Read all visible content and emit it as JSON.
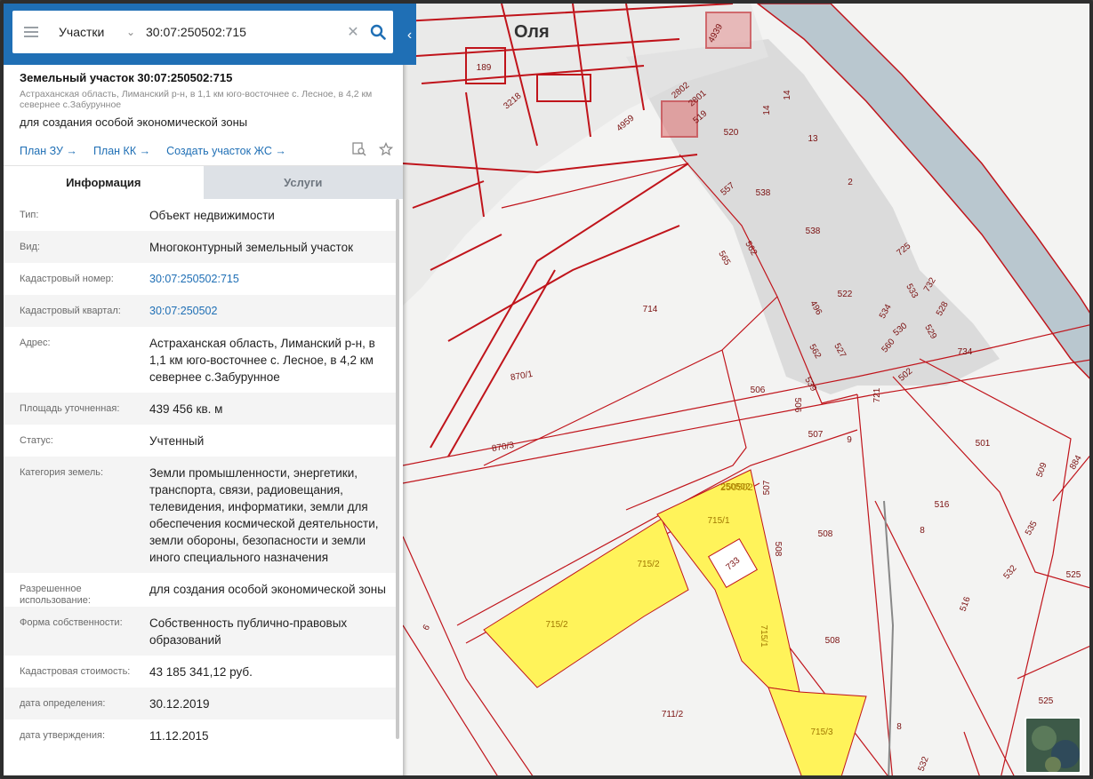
{
  "search": {
    "layer": "Участки",
    "query": "30:07:250502:715"
  },
  "object": {
    "title": "Земельный участок 30:07:250502:715",
    "address_short": "Астраханская область, Лиманский р-н, в 1,1 км юго-восточнее с. Лесное, в 4,2 км севернее с.Забурунное",
    "purpose": "для создания особой экономической зоны",
    "links": [
      "План ЗУ →",
      "План КК →",
      "Создать участок ЖС →"
    ]
  },
  "tabs": [
    "Информация",
    "Услуги"
  ],
  "attributes": [
    {
      "label": "Тип:",
      "value": "Объект недвижимости"
    },
    {
      "label": "Вид:",
      "value": "Многоконтурный земельный участок"
    },
    {
      "label": "Кадастровый номер:",
      "value": "30:07:250502:715",
      "link": true
    },
    {
      "label": "Кадастровый квартал:",
      "value": "30:07:250502",
      "link": true
    },
    {
      "label": "Адрес:",
      "value": "Астраханская область, Лиманский р-н, в 1,1 км юго-восточнее с. Лесное, в 4,2 км севернее с.Забурунное"
    },
    {
      "label": "Площадь уточненная:",
      "value": "439 456 кв. м"
    },
    {
      "label": "Статус:",
      "value": "Учтенный"
    },
    {
      "label": "Категория земель:",
      "value": "Земли промышленности, энергетики, транспорта, связи, радиовещания, телевидения, информатики, земли для обеспечения космической деятельности, земли обороны, безопасности и земли иного специального назначения"
    },
    {
      "label": "Разрешенное использование:",
      "value": "для создания особой экономической зоны"
    },
    {
      "label": "Форма собственности:",
      "value": "Собственность публично-правовых образований"
    },
    {
      "label": "Кадастровая стоимость:",
      "value": "43 185 341,12 руб."
    },
    {
      "label": "дата определения:",
      "value": "30.12.2019"
    },
    {
      "label": "дата утверждения:",
      "value": "11.12.2015"
    }
  ],
  "map": {
    "town_label": "Оля",
    "quarter_label": "250502",
    "colors": {
      "parcel_line": "#c0141b",
      "selected_fill": "#fff35a",
      "river": "#b9c7cf",
      "built_area": "#d8d8d8"
    },
    "parcel_labels": [
      "4939",
      "189",
      "3218",
      "2802",
      "2801",
      "519",
      "4959",
      "520",
      "14",
      "14",
      "13",
      "2",
      "557",
      "538",
      "538",
      "725",
      "565",
      "562",
      "533",
      "732",
      "528",
      "522",
      "714",
      "496",
      "534",
      "530",
      "529",
      "560",
      "734",
      "527",
      "562",
      "539",
      "506",
      "502",
      "721",
      "870/1",
      "506",
      "870/3",
      "507",
      "9",
      "501",
      "509",
      "884",
      "250502",
      "507",
      "715/1",
      "516",
      "535",
      "715/2",
      "733",
      "508",
      "508",
      "8",
      "532",
      "525",
      "6",
      "715/2",
      "715/1",
      "508",
      "516",
      "525",
      "711/2",
      "715/3",
      "8",
      "532"
    ]
  }
}
